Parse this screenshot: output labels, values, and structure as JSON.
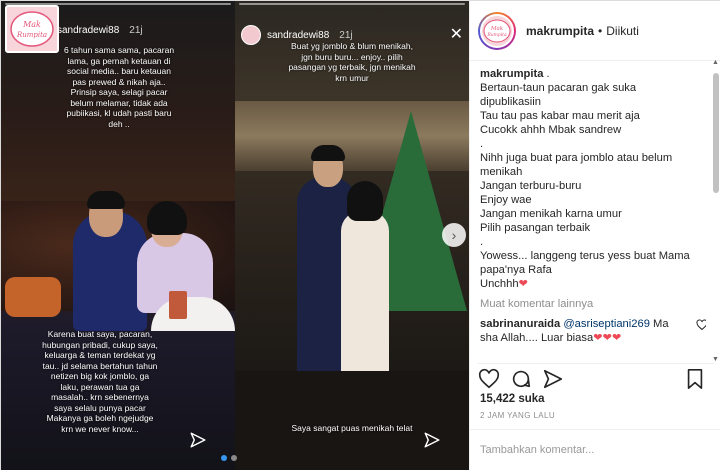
{
  "media": {
    "story_left": {
      "username": "sandradewi88",
      "time": "21j",
      "text_top": "6 tahun sama sama, pacaran lama, ga pernah ketauan di social media.. baru ketauan pas prewed & nikah aja.. Prinsip saya, selagi pacar belum melamar, tidak ada pubiikasi, kl udah pasti baru deh ..",
      "text_bottom": "Karena buat saya, pacaran, hubungan pribadi, cukup saya, keluarga & teman terdekat yg tau.. jd selama bertahun tahun netizen big kok jomblo, ga laku, perawan tua ga masalah.. krn sebenernya saya selalu punya pacar Makanya ga boleh ngejudge krn we never know..."
    },
    "story_right": {
      "username": "sandradewi88",
      "time": "21j",
      "text_top": "Buat yg jomblo & blum menikah, jgn buru buru... enjoy.. pilih pasangan yg terbaik, jgn menikah krn umur",
      "text_bottom": "Saya sangat puas menikah telat"
    },
    "logo_text": "Mak Rumpita",
    "carousel_next_icon": "chevron-right"
  },
  "header": {
    "username": "makrumpita",
    "separator": "•",
    "follow_status": "Diikuti"
  },
  "caption": {
    "username": "makrumpita",
    "first_line": ".",
    "lines": [
      "Bertaun-taun pacaran gak suka",
      "dipublikasiin",
      "Tau tau pas kabar mau merit aja",
      "Cucokk ahhh Mbak sandrew",
      ".",
      "Nihh juga buat para jomblo atau belum",
      "menikah",
      "Jangan terburu-buru",
      "Enjoy wae",
      "Jangan menikah karna umur",
      "Pilih pasangan terbaik",
      ".",
      "Yowess... langgeng terus yess buat Mama",
      "papa'nya Rafa"
    ],
    "last_line": "Unchhh"
  },
  "more_comments": "Muat komentar lainnya",
  "comment": {
    "username": "sabrinanuraida",
    "mention": "@asriseptiani269",
    "text_1": "Ma",
    "text_2": "sha Allah.... Luar biasa"
  },
  "likes": "15,422 suka",
  "time_ago": "2 JAM YANG LALU",
  "add_comment_placeholder": "Tambahkan komentar...",
  "colors": {
    "accent": "#3897f0",
    "heart": "#ed4956",
    "muted": "#8e8e8e"
  }
}
